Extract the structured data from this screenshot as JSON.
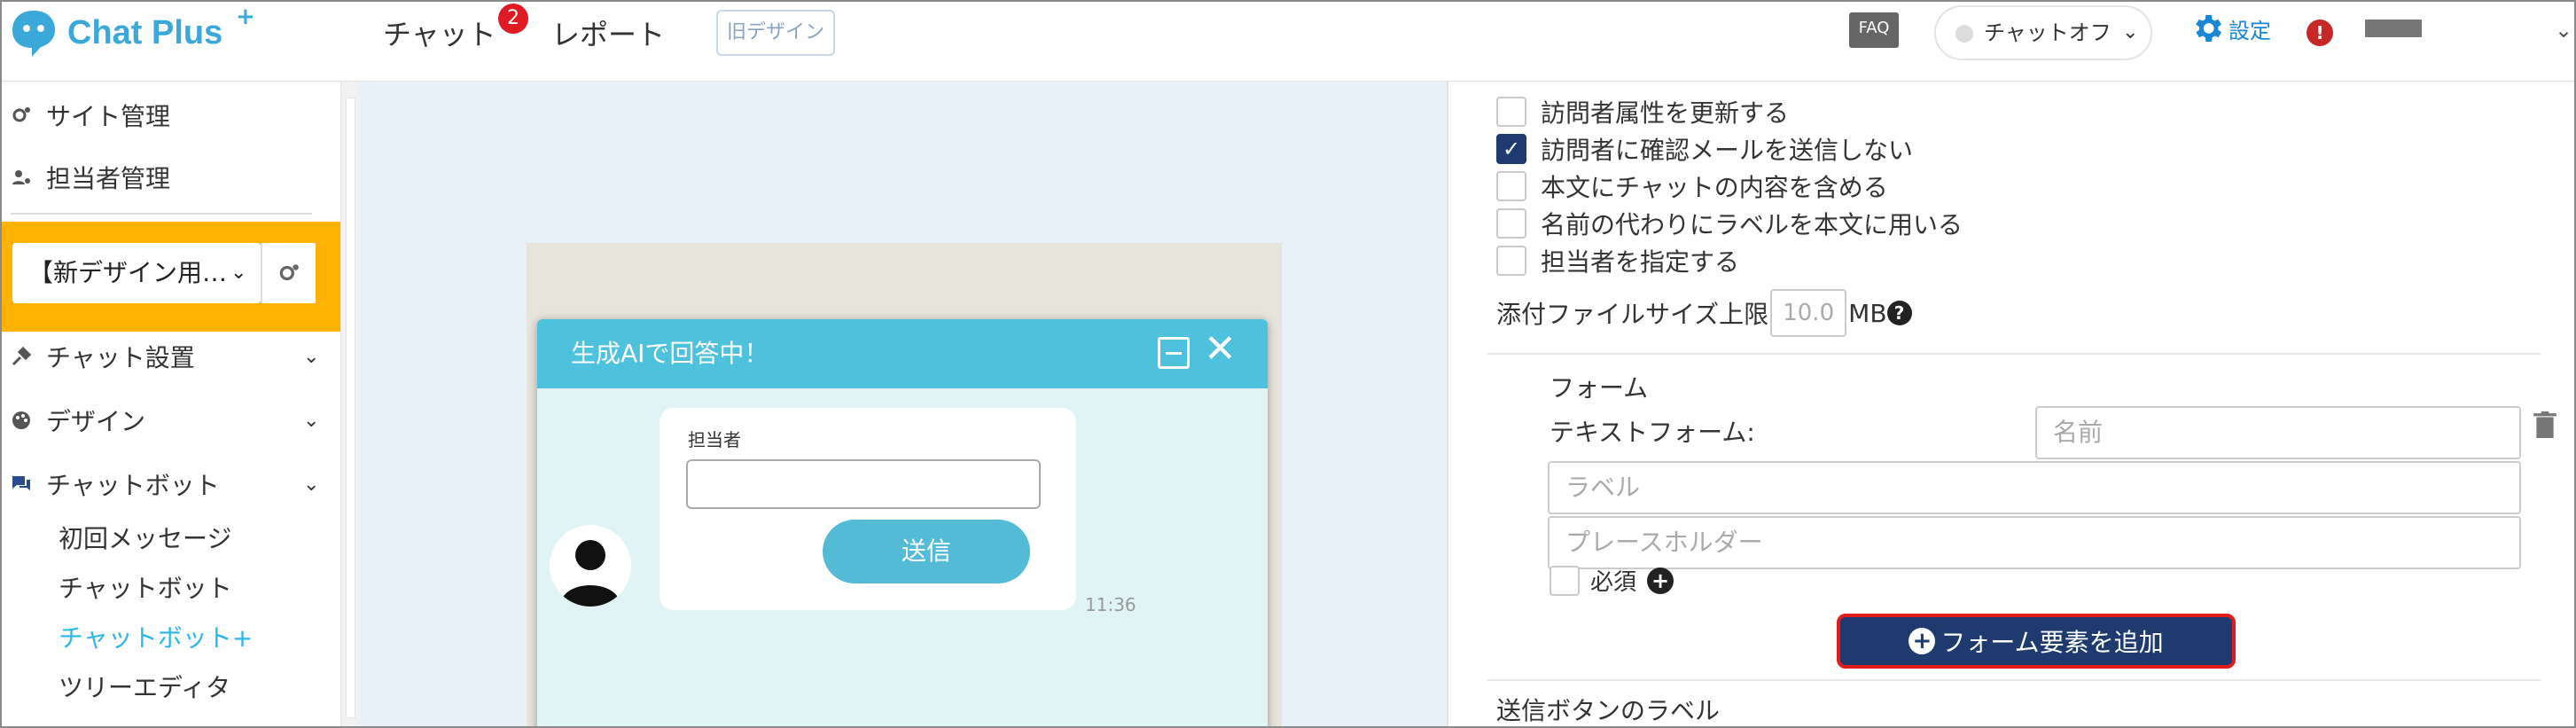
{
  "header": {
    "logo_text": "Chat Plus",
    "logo_plus": "+",
    "nav_chat": "チャット",
    "nav_chat_badge": "2",
    "nav_report": "レポート",
    "old_design": "旧デザイン",
    "faq": "FAQ",
    "status": "チャットオフ",
    "settings": "設定",
    "alert": "!"
  },
  "sidebar": {
    "site_admin": "サイト管理",
    "staff_admin": "担当者管理",
    "site_select": "【新デザイン用…",
    "chat_setup": "チャット設置",
    "design": "デザイン",
    "chatbot": "チャットボット",
    "sub_items": [
      "初回メッセージ",
      "チャットボット",
      "チャットボット+",
      "ツリーエディタ"
    ]
  },
  "preview": {
    "header_title": "生成AIで回答中！",
    "form_label": "担当者",
    "send_button": "送信",
    "time": "11:36"
  },
  "panel": {
    "checkboxes": [
      {
        "label": "訪問者属性を更新する",
        "checked": false
      },
      {
        "label": "訪問者に確認メールを送信しない",
        "checked": true
      },
      {
        "label": "本文にチャットの内容を含める",
        "checked": false
      },
      {
        "label": "名前の代わりにラベルを本文に用いる",
        "checked": false
      },
      {
        "label": "担当者を指定する",
        "checked": false
      }
    ],
    "file_size_label": "添付ファイルサイズ上限",
    "file_size_value": "10.0",
    "file_size_unit": "MB",
    "form_title": "フォーム",
    "text_form_label": "テキストフォーム:",
    "name_placeholder": "名前",
    "label_placeholder": "ラベル",
    "placeholder_placeholder": "プレースホルダー",
    "required_label": "必須",
    "add_form_element": "フォーム要素を追加",
    "send_button_label": "送信ボタンのラベル"
  },
  "colors": {
    "brand": "#3aa8d8",
    "accent_yellow": "#ffb300",
    "chat_header": "#4ec1dc",
    "primary_button": "#1e3a6e",
    "highlight_border": "#e21b1b",
    "active_link": "#29b6e8"
  },
  "icons": [
    "chat-bubble-logo-icon",
    "gear-icon",
    "user-icon",
    "tools-icon",
    "palette-icon",
    "chat-icon",
    "chevron-down-icon",
    "trash-icon",
    "question-icon",
    "plus-circle-icon",
    "minimize-icon",
    "close-icon",
    "avatar-icon",
    "check-icon"
  ]
}
